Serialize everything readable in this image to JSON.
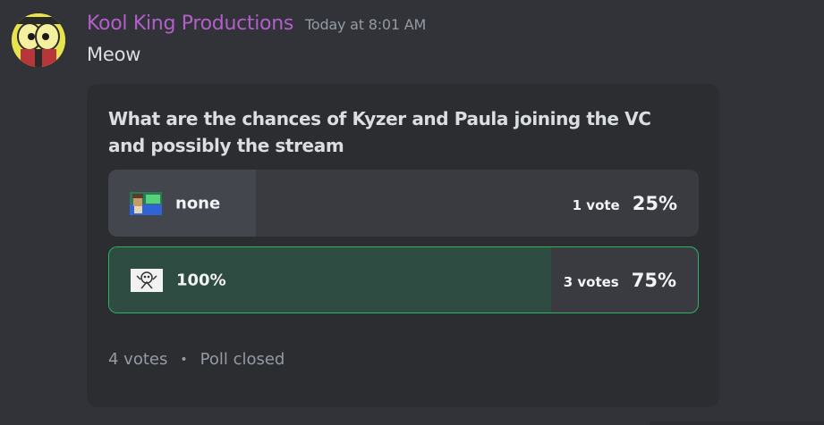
{
  "message": {
    "author": "Kool King Productions",
    "timestamp": "Today at 8:01 AM",
    "content": "Meow",
    "author_color": "#b35fc9"
  },
  "poll": {
    "question": "What are the chances of Kyzer and Paula joining the VC and possibly the stream",
    "answers": [
      {
        "label": "none",
        "votes": "1 vote",
        "percent": "25%",
        "fraction": 0.25,
        "emoji": "pixel-character-emoji",
        "selected": false
      },
      {
        "label": "100%",
        "votes": "3 votes",
        "percent": "75%",
        "fraction": 0.75,
        "emoji": "skull-sketch-emoji",
        "selected": true
      }
    ],
    "total_votes": "4 votes",
    "status": "Poll closed",
    "accent_color": "#2fb463"
  }
}
